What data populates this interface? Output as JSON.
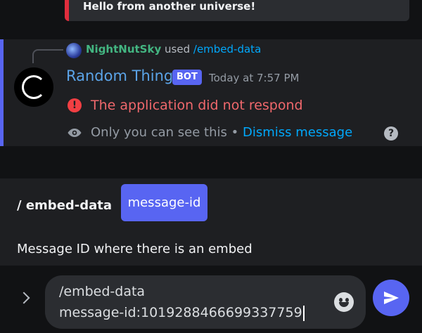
{
  "previous_embed": {
    "text": "Hello from another universe!",
    "accent": "#e02d3d"
  },
  "reply": {
    "user": "NightNutSky",
    "used": "used",
    "command": "/embed-data"
  },
  "message": {
    "author": "Random Thing",
    "bot_tag": "BOT",
    "timestamp": "Today at 7:57 PM",
    "error_icon": "!",
    "error_text": "The application did not respond",
    "only_you": "Only you can see this",
    "separator": "•",
    "dismiss": "Dismiss message",
    "help_icon": "?"
  },
  "options_panel": {
    "command": "/ embed-data",
    "option": "message-id",
    "description": "Message ID where there is an embed"
  },
  "composer": {
    "line1": "/embed-data",
    "line2": "message-id:1019288466699337759"
  },
  "colors": {
    "blurple": "#5865f2",
    "error": "#f0686c",
    "link": "#00a8fc"
  }
}
